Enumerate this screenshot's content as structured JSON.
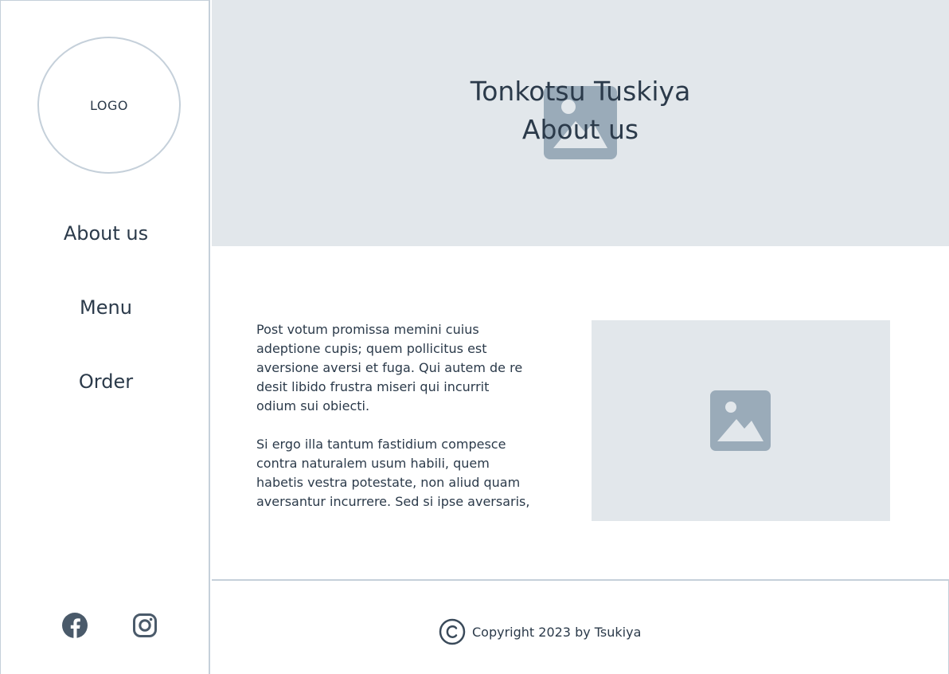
{
  "sidebar": {
    "logo_text": "LOGO",
    "nav": [
      {
        "label": "About us"
      },
      {
        "label": "Menu"
      },
      {
        "label": "Order"
      }
    ],
    "social": [
      "facebook-icon",
      "instagram-icon"
    ]
  },
  "hero": {
    "title": "Tonkotsu Tuskiya",
    "subtitle": "About us",
    "image_icon": "image-placeholder-icon"
  },
  "content": {
    "paragraphs": [
      "Post votum promissa memini cuius adeptione cupis; quem pollicitus est aversione aversi et fuga. Qui autem de re desit libido frustra miseri qui incurrit odium sui obiecti.",
      "Si ergo illa tantum fastidium compesce contra naturalem usum habili, quem habetis vestra potestate, non aliud quam aversantur incurrere. Sed si ipse aversaris,"
    ],
    "image_icon": "image-placeholder-icon"
  },
  "footer": {
    "copyright": "Copyright 2023 by Tsukiya"
  },
  "colors": {
    "text": "#2b3a4a",
    "placeholder_bg": "#e2e7eb",
    "placeholder_icon": "#9aabb9",
    "border": "#c5d0da"
  }
}
